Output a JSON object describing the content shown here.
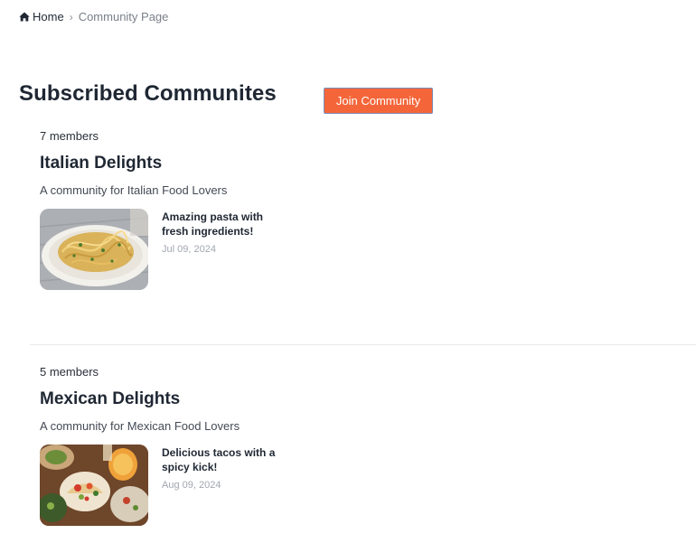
{
  "breadcrumb": {
    "home_label": "Home",
    "home_icon": "home-icon",
    "separator": "›",
    "current_label": "Community Page"
  },
  "page": {
    "title": "Subscribed Communites",
    "join_button_label": "Join Community"
  },
  "colors": {
    "accent": "#f4663a",
    "text_dark": "#1f2733",
    "text_muted": "#7b808a",
    "date_gray": "#a1a6b0"
  },
  "communities": [
    {
      "members": "7 members",
      "name": "Italian Delights",
      "description": "A community for Italian Food Lovers",
      "post": {
        "title": "Amazing pasta with fresh ingredients!",
        "date": "Jul 09, 2024",
        "image": "pasta-dish-image"
      }
    },
    {
      "members": "5 members",
      "name": "Mexican Delights",
      "description": "A community for Mexican Food Lovers",
      "post": {
        "title": "Delicious tacos with a spicy kick!",
        "date": "Aug 09, 2024",
        "image": "tacos-spread-image"
      }
    }
  ]
}
